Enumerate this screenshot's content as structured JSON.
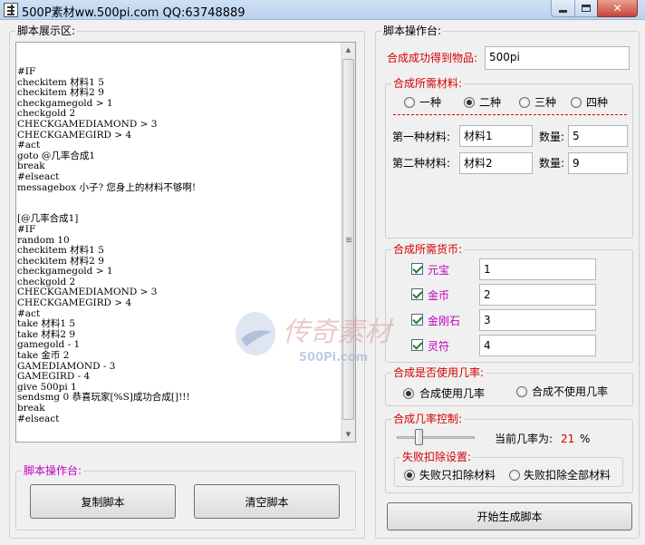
{
  "window": {
    "title": "500P素材ww.500pi.com QQ:63748889",
    "min_icon": "minimize-icon",
    "max_icon": "maximize-icon",
    "close_icon": "close-icon",
    "close_label": "✕"
  },
  "left": {
    "group_title": "脚本展示区:",
    "script_lines": [
      "#IF",
      "checkitem 材料1 5",
      "checkitem 材料2 9",
      "checkgamegold > 1",
      "checkgold 2",
      "CHECKGAMEDIAMOND > 3",
      "CHECKGAMEGIRD > 4",
      "#act",
      "goto @几率合成1",
      "break",
      "#elseact",
      "messagebox 小子? 您身上的材料不够啊!",
      "",
      "",
      "[@几率合成1]",
      "#IF",
      "random 10",
      "checkitem 材料1 5",
      "checkitem 材料2 9",
      "checkgamegold > 1",
      "checkgold 2",
      "CHECKGAMEDIAMOND > 3",
      "CHECKGAMEGIRD > 4",
      "#act",
      "take 材料1 5",
      "take 材料2 9",
      "gamegold - 1",
      "take 金币 2",
      "GAMEDIAMOND - 3",
      "GAMEGIRD - 4",
      "give 500pi 1",
      "sendsmg 0 恭喜玩家[%S]成功合成[]!!!",
      "break",
      "#elseact"
    ],
    "console_title": "脚本操作台:",
    "copy_button": "复制脚本",
    "clear_button": "清空脚本",
    "scroll_up_icon": "▲",
    "scroll_down_icon": "▼"
  },
  "right": {
    "group_title": "脚本操作台:",
    "result_label": "合成成功得到物品:",
    "result_value": "500pi",
    "materials": {
      "title": "合成所需材料:",
      "options": [
        "一种",
        "二种",
        "三种",
        "四种"
      ],
      "selected_index": 1,
      "mat1_label": "第一种材料:",
      "mat1_value": "材料1",
      "qty1_label": "数量:",
      "qty1_value": "5",
      "mat2_label": "第二种材料:",
      "mat2_value": "材料2",
      "qty2_label": "数量:",
      "qty2_value": "9"
    },
    "currency": {
      "title": "合成所需货币:",
      "items": [
        {
          "label": "元宝",
          "value": "1",
          "checked": true
        },
        {
          "label": "金币",
          "value": "2",
          "checked": true
        },
        {
          "label": "金刚石",
          "value": "3",
          "checked": true
        },
        {
          "label": "灵符",
          "value": "4",
          "checked": true
        }
      ]
    },
    "use_rate": {
      "title": "合成是否使用几率:",
      "yes_label": "合成使用几率",
      "no_label": "合成不使用几率",
      "selected": "yes"
    },
    "rate_control": {
      "title": "合成几率控制:",
      "current_label": "当前几率为:",
      "current_value": "21",
      "unit": "%",
      "slider_fraction": 0.21,
      "fail_title": "失败扣除设置:",
      "fail_only_label": "失败只扣除材料",
      "fail_all_label": "失败扣除全部材料",
      "fail_selected": "only"
    },
    "generate_button": "开始生成脚本"
  },
  "colors": {
    "accent_red": "#d40000",
    "accent_magenta": "#c000c0"
  }
}
